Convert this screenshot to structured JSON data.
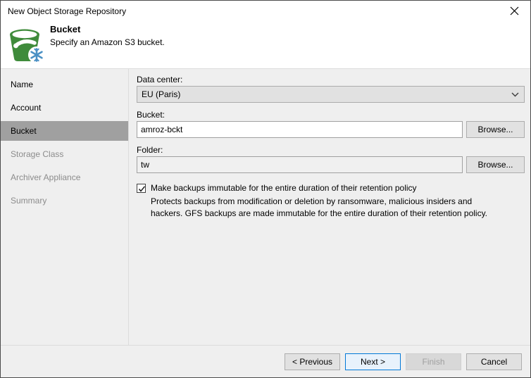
{
  "window": {
    "title": "New Object Storage Repository",
    "close_icon": "close-icon"
  },
  "header": {
    "icon": "bucket-snowflake-icon",
    "title": "Bucket",
    "subtitle": "Specify an Amazon S3 bucket.",
    "colors": {
      "bucket_green": "#3f8b3b",
      "snowflake_blue": "#4a90c4"
    }
  },
  "sidebar": {
    "items": [
      {
        "label": "Name",
        "state": "done"
      },
      {
        "label": "Account",
        "state": "done"
      },
      {
        "label": "Bucket",
        "state": "current"
      },
      {
        "label": "Storage Class",
        "state": "pending"
      },
      {
        "label": "Archiver Appliance",
        "state": "pending"
      },
      {
        "label": "Summary",
        "state": "pending"
      }
    ],
    "selected_color": "#a0a0a0"
  },
  "main": {
    "data_center": {
      "label": "Data center:",
      "value": "EU (Paris)",
      "arrow_icon": "chevron-down-icon"
    },
    "bucket": {
      "label": "Bucket:",
      "value": "amroz-bckt",
      "placeholder": "",
      "browse_label": "Browse..."
    },
    "folder": {
      "label": "Folder:",
      "value": "tw",
      "placeholder": "",
      "browse_label": "Browse..."
    },
    "immutability": {
      "checked": true,
      "check_icon": "checkmark-icon",
      "label": "Make backups immutable for the entire duration of their retention policy",
      "description": "Protects backups from modification or deletion by ransomware, malicious insiders and hackers. GFS backups are made immutable for the entire duration of their retention policy."
    }
  },
  "footer": {
    "previous_label": "< Previous",
    "next_label": "Next >",
    "finish_label": "Finish",
    "cancel_label": "Cancel",
    "finish_disabled": true,
    "default_button": "Next >",
    "accent_color": "#0078d7"
  }
}
